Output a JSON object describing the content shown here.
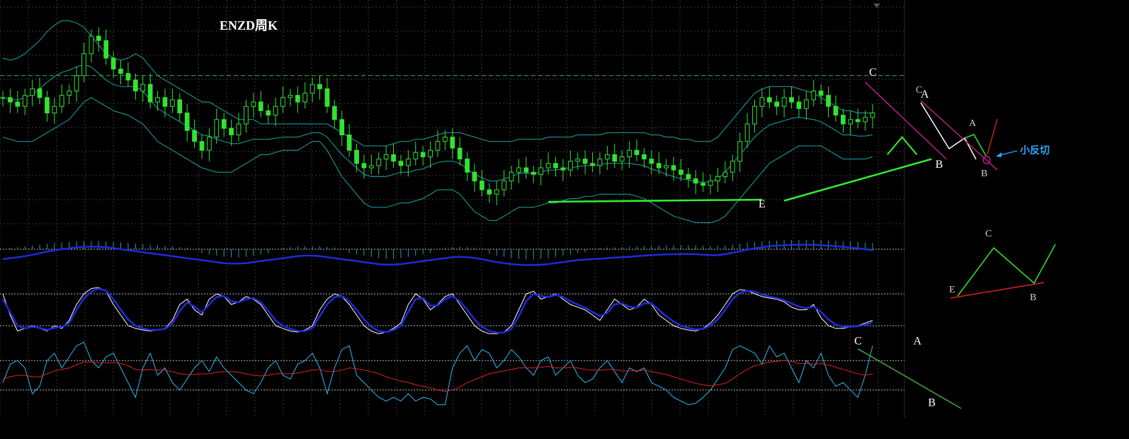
{
  "colors": {
    "background": "#000000",
    "grid": "#3a3a3a",
    "candle_up": "#000000",
    "candle_outline": "#33e233",
    "bollinger": "#1aa5a5",
    "trendline": "#33ee33",
    "resistance": "#d0228f",
    "macd_hist": "#1aa5a5",
    "macd_signal": "#1e2bd8",
    "stoch_main": "#ffffff",
    "stoch_signal": "#1e2bd8",
    "rsi_main": "#2bb8f0",
    "rsi_signal": "#e02020",
    "note": "#2aa7ff"
  },
  "chart_data": {
    "type": "line",
    "title": "ENZD周K",
    "price_panel": {
      "ylim": [
        0,
        100
      ],
      "mid_level": 72,
      "close": [
        62,
        60,
        58,
        63,
        66,
        62,
        55,
        58,
        63,
        65,
        72,
        82,
        90,
        88,
        80,
        75,
        73,
        70,
        65,
        68,
        60,
        62,
        58,
        61,
        55,
        47,
        42,
        38,
        44,
        52,
        48,
        45,
        50,
        58,
        60,
        56,
        54,
        58,
        62,
        63,
        60,
        64,
        68,
        66,
        58,
        52,
        45,
        38,
        32,
        30,
        31,
        34,
        36,
        33,
        31,
        34,
        37,
        35,
        38,
        42,
        44,
        39,
        34,
        28,
        24,
        20,
        18,
        20,
        24,
        28,
        30,
        28,
        27,
        30,
        32,
        30,
        29,
        33,
        34,
        32,
        31,
        34,
        36,
        33,
        35,
        38,
        36,
        34,
        32,
        30,
        31,
        29,
        27,
        25,
        23,
        22,
        24,
        26,
        28,
        33,
        42,
        50,
        58,
        62,
        60,
        58,
        62,
        60,
        57,
        61,
        65,
        63,
        58,
        54,
        50,
        52,
        51,
        53,
        55
      ],
      "bb_upper": [
        80,
        79,
        80,
        82,
        85,
        88,
        92,
        95,
        97,
        97,
        96,
        94,
        90,
        86,
        82,
        80,
        79,
        80,
        82,
        80,
        76,
        72,
        70,
        68,
        66,
        64,
        62,
        60,
        60,
        58,
        56,
        54,
        52,
        52,
        52,
        50,
        50,
        50,
        50,
        50,
        50,
        50,
        50,
        50,
        50,
        48,
        46,
        44,
        42,
        40,
        40,
        40,
        40,
        41,
        42,
        42,
        43,
        43,
        44,
        45,
        46,
        46,
        46,
        45,
        44,
        43,
        42,
        42,
        42,
        42,
        43,
        43,
        43,
        43,
        44,
        44,
        44,
        44,
        45,
        45,
        45,
        45,
        46,
        46,
        46,
        46,
        46,
        46,
        45,
        45,
        44,
        44,
        43,
        43,
        42,
        42,
        42,
        44,
        48,
        52,
        56,
        60,
        64,
        66,
        67,
        67,
        67,
        67,
        66,
        65,
        64,
        62,
        60,
        58,
        56,
        56,
        55,
        55,
        55
      ],
      "bb_lower": [
        44,
        43,
        42,
        42,
        42,
        44,
        46,
        48,
        50,
        52,
        56,
        60,
        62,
        60,
        58,
        56,
        55,
        54,
        52,
        50,
        46,
        42,
        40,
        38,
        36,
        34,
        32,
        30,
        29,
        28,
        28,
        28,
        30,
        32,
        34,
        36,
        36,
        37,
        38,
        38,
        38,
        40,
        42,
        42,
        38,
        32,
        26,
        22,
        18,
        14,
        12,
        12,
        12,
        13,
        14,
        14,
        15,
        16,
        18,
        20,
        20,
        20,
        18,
        14,
        10,
        8,
        6,
        6,
        8,
        10,
        12,
        12,
        12,
        13,
        14,
        14,
        15,
        16,
        16,
        17,
        17,
        18,
        18,
        18,
        18,
        18,
        17,
        16,
        14,
        12,
        10,
        8,
        7,
        6,
        5,
        5,
        5,
        6,
        8,
        12,
        16,
        20,
        24,
        28,
        32,
        34,
        36,
        38,
        40,
        40,
        40,
        40,
        38,
        36,
        34,
        34,
        34,
        34,
        35
      ],
      "support_line": {
        "from": [
          74,
          14.5
        ],
        "to": [
          103,
          15.5
        ]
      },
      "rising_line": {
        "from": [
          106,
          15
        ],
        "to": [
          126,
          34
        ]
      },
      "falling_line": {
        "from": [
          117,
          69
        ],
        "to": [
          128,
          34
        ]
      },
      "labels": [
        {
          "text": "C",
          "x": 118,
          "y": 72
        },
        {
          "text": "A",
          "x": 125,
          "y": 62
        },
        {
          "text": "B",
          "x": 127,
          "y": 30
        },
        {
          "text": "E",
          "x": 103,
          "y": 12
        }
      ]
    },
    "macd_panel": {
      "ylim": [
        -1,
        1
      ],
      "signal": [
        0.0,
        0.05,
        0.1,
        0.15,
        0.22,
        0.3,
        0.38,
        0.45,
        0.5,
        0.55,
        0.6,
        0.62,
        0.63,
        0.63,
        0.6,
        0.56,
        0.5,
        0.45,
        0.4,
        0.35,
        0.3,
        0.25,
        0.2,
        0.15,
        0.1,
        0.05,
        0.0,
        -0.05,
        -0.1,
        -0.15,
        -0.2,
        -0.22,
        -0.22,
        -0.2,
        -0.15,
        -0.1,
        -0.05,
        0.0,
        0.05,
        0.1,
        0.15,
        0.18,
        0.18,
        0.15,
        0.1,
        0.05,
        0.0,
        -0.05,
        -0.1,
        -0.15,
        -0.2,
        -0.25,
        -0.28,
        -0.28,
        -0.25,
        -0.2,
        -0.15,
        -0.1,
        -0.05,
        0.0,
        0.05,
        0.1,
        0.12,
        0.1,
        0.06,
        0.0,
        -0.08,
        -0.15,
        -0.2,
        -0.25,
        -0.28,
        -0.3,
        -0.3,
        -0.28,
        -0.25,
        -0.2,
        -0.15,
        -0.1,
        -0.05,
        -0.02,
        0.0,
        0.02,
        0.05,
        0.08,
        0.1,
        0.12,
        0.15,
        0.18,
        0.2,
        0.22,
        0.24,
        0.25,
        0.26,
        0.26,
        0.25,
        0.22,
        0.2,
        0.2,
        0.25,
        0.32,
        0.4,
        0.48,
        0.55,
        0.6,
        0.65,
        0.68,
        0.7,
        0.72,
        0.73,
        0.73,
        0.72,
        0.7,
        0.68,
        0.65,
        0.62,
        0.58,
        0.55,
        0.5,
        0.45
      ]
    },
    "stoch_panel": {
      "ylim": [
        0,
        100
      ],
      "levels": [
        80,
        20
      ],
      "main": [
        80,
        40,
        10,
        15,
        20,
        15,
        10,
        20,
        15,
        30,
        60,
        80,
        90,
        92,
        85,
        60,
        40,
        20,
        15,
        12,
        10,
        12,
        15,
        30,
        60,
        70,
        50,
        40,
        70,
        80,
        75,
        60,
        65,
        75,
        70,
        60,
        40,
        20,
        15,
        10,
        8,
        12,
        20,
        50,
        70,
        80,
        75,
        60,
        40,
        20,
        10,
        5,
        8,
        15,
        25,
        60,
        80,
        70,
        50,
        60,
        75,
        80,
        60,
        40,
        20,
        10,
        5,
        5,
        8,
        20,
        50,
        80,
        85,
        70,
        75,
        80,
        70,
        60,
        55,
        50,
        40,
        30,
        50,
        70,
        60,
        50,
        55,
        70,
        60,
        40,
        30,
        20,
        15,
        12,
        10,
        15,
        25,
        40,
        60,
        80,
        88,
        86,
        80,
        75,
        72,
        70,
        65,
        55,
        50,
        50,
        60,
        35,
        20,
        15,
        15,
        18,
        20,
        25,
        30
      ],
      "signal": [
        70,
        45,
        20,
        15,
        18,
        16,
        12,
        16,
        18,
        25,
        50,
        72,
        84,
        90,
        86,
        70,
        50,
        32,
        20,
        15,
        12,
        12,
        14,
        24,
        48,
        64,
        56,
        45,
        60,
        74,
        76,
        66,
        64,
        70,
        72,
        64,
        48,
        30,
        20,
        14,
        10,
        10,
        16,
        38,
        60,
        74,
        76,
        66,
        50,
        32,
        18,
        10,
        8,
        12,
        20,
        46,
        70,
        72,
        58,
        58,
        70,
        76,
        66,
        50,
        32,
        18,
        10,
        7,
        7,
        14,
        38,
        66,
        80,
        76,
        74,
        78,
        74,
        66,
        60,
        54,
        46,
        38,
        44,
        60,
        62,
        56,
        54,
        62,
        62,
        50,
        38,
        28,
        20,
        16,
        13,
        14,
        20,
        32,
        50,
        70,
        82,
        86,
        84,
        79,
        75,
        72,
        68,
        62,
        56,
        53,
        56,
        46,
        32,
        22,
        18,
        18,
        19,
        22,
        26
      ]
    },
    "rsi_panel": {
      "ylim": [
        0,
        100
      ],
      "levels": [
        70,
        30
      ],
      "main": [
        40,
        65,
        70,
        60,
        25,
        35,
        70,
        80,
        60,
        75,
        90,
        95,
        70,
        60,
        75,
        80,
        60,
        40,
        20,
        60,
        80,
        50,
        60,
        40,
        30,
        45,
        60,
        70,
        55,
        75,
        60,
        50,
        40,
        30,
        25,
        40,
        60,
        70,
        50,
        45,
        65,
        70,
        80,
        60,
        25,
        60,
        85,
        90,
        50,
        40,
        30,
        20,
        15,
        20,
        15,
        25,
        15,
        20,
        18,
        10,
        10,
        60,
        80,
        90,
        70,
        85,
        80,
        60,
        70,
        85,
        75,
        60,
        50,
        70,
        75,
        50,
        60,
        70,
        50,
        40,
        45,
        60,
        70,
        55,
        40,
        60,
        55,
        60,
        40,
        35,
        30,
        20,
        15,
        10,
        12,
        20,
        30,
        45,
        60,
        85,
        90,
        85,
        80,
        65,
        90,
        75,
        80,
        60,
        40,
        70,
        60,
        80,
        50,
        35,
        40,
        30,
        20,
        50,
        90
      ],
      "signal": [
        45,
        48,
        50,
        50,
        48,
        48,
        52,
        56,
        58,
        60,
        64,
        68,
        68,
        67,
        67,
        67,
        66,
        63,
        58,
        57,
        58,
        57,
        57,
        55,
        52,
        51,
        51,
        52,
        52,
        54,
        55,
        55,
        54,
        52,
        50,
        49,
        50,
        52,
        52,
        52,
        53,
        55,
        57,
        58,
        55,
        55,
        57,
        60,
        59,
        57,
        55,
        52,
        48,
        45,
        42,
        40,
        37,
        35,
        33,
        30,
        28,
        30,
        34,
        40,
        44,
        48,
        52,
        54,
        56,
        58,
        60,
        60,
        60,
        61,
        62,
        60,
        60,
        61,
        60,
        58,
        57,
        57,
        58,
        58,
        56,
        56,
        56,
        57,
        55,
        53,
        51,
        48,
        45,
        42,
        39,
        37,
        36,
        37,
        39,
        45,
        52,
        58,
        63,
        65,
        68,
        69,
        70,
        69,
        66,
        66,
        65,
        66,
        64,
        61,
        58,
        55,
        52,
        50,
        52
      ],
      "falling_line": {
        "from": [
          116,
          86
        ],
        "to": [
          130,
          5
        ]
      },
      "labels": [
        {
          "text": "C",
          "x": 116,
          "y": 92
        },
        {
          "text": "A",
          "x": 124,
          "y": 92
        },
        {
          "text": "B",
          "x": 126,
          "y": 8
        }
      ]
    }
  },
  "legend_diagrams": {
    "top": {
      "labels": [
        "C",
        "A",
        "B"
      ],
      "note": "小反切"
    },
    "bottom": {
      "labels": [
        "C",
        "E",
        "B"
      ]
    }
  }
}
